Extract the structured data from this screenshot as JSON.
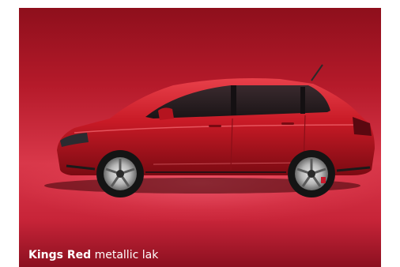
{
  "image_viewer": {
    "color_name": "Kings Red",
    "color_finish": "metallic lak",
    "accent_color": "#c8192c",
    "subject_icon": "car-hatchback-side-view"
  }
}
